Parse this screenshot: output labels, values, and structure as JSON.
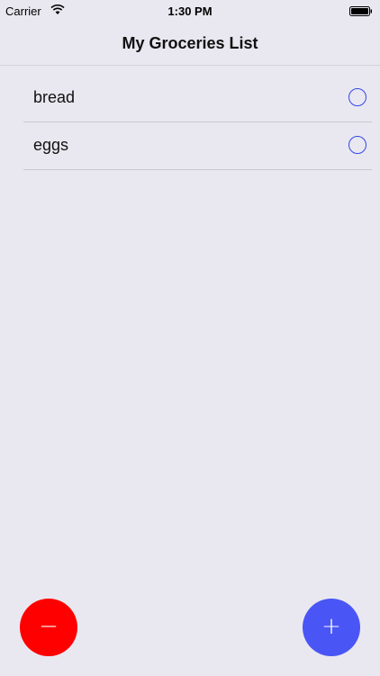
{
  "status_bar": {
    "carrier": "Carrier",
    "time": "1:30 PM"
  },
  "header": {
    "title": "My Groceries List"
  },
  "items": [
    {
      "label": "bread",
      "checked": false
    },
    {
      "label": "eggs",
      "checked": false
    }
  ],
  "buttons": {
    "remove_label": "−",
    "add_label": "+"
  },
  "colors": {
    "background": "#e9e8f0",
    "check_accent": "#3347e8",
    "remove_button": "#ff0000",
    "add_button": "#4a55f5"
  },
  "icons": {
    "wifi": "wifi-icon",
    "battery": "battery-icon",
    "check": "circle-check-icon"
  }
}
